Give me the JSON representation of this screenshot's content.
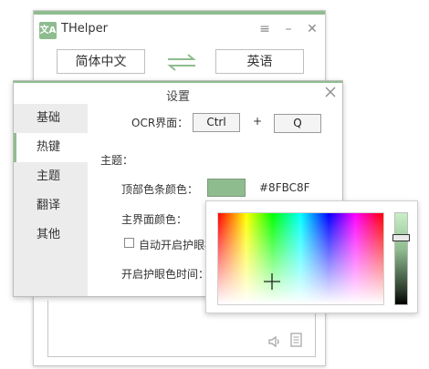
{
  "main_window": {
    "title": "THelper",
    "logo_text": "文A",
    "source_lang": "简体中文",
    "target_lang": "英语",
    "buttons": {
      "menu": "≡",
      "minimize": "–",
      "close": "✕"
    }
  },
  "settings": {
    "title": "设置",
    "nav": [
      {
        "label": "基础",
        "active": false
      },
      {
        "label": "热键",
        "active": true
      },
      {
        "label": "主题",
        "active": false
      },
      {
        "label": "翻译",
        "active": false
      },
      {
        "label": "其他",
        "active": false
      }
    ],
    "ocr_label": "OCR界面：",
    "ocr_key1": "Ctrl",
    "plus": "+",
    "ocr_key2": "Q",
    "theme_heading": "主题：",
    "topbar_color_label": "顶部色条颜色：",
    "topbar_color_value": "#8FBC8F",
    "main_color_label": "主界面颜色：",
    "auto_eye_label": "自动开启护眼模式",
    "eye_time_label": "开启护眼色时间："
  },
  "colors": {
    "accent": "#8FBC8F"
  },
  "color_picker": {
    "value_level": 0.25
  }
}
